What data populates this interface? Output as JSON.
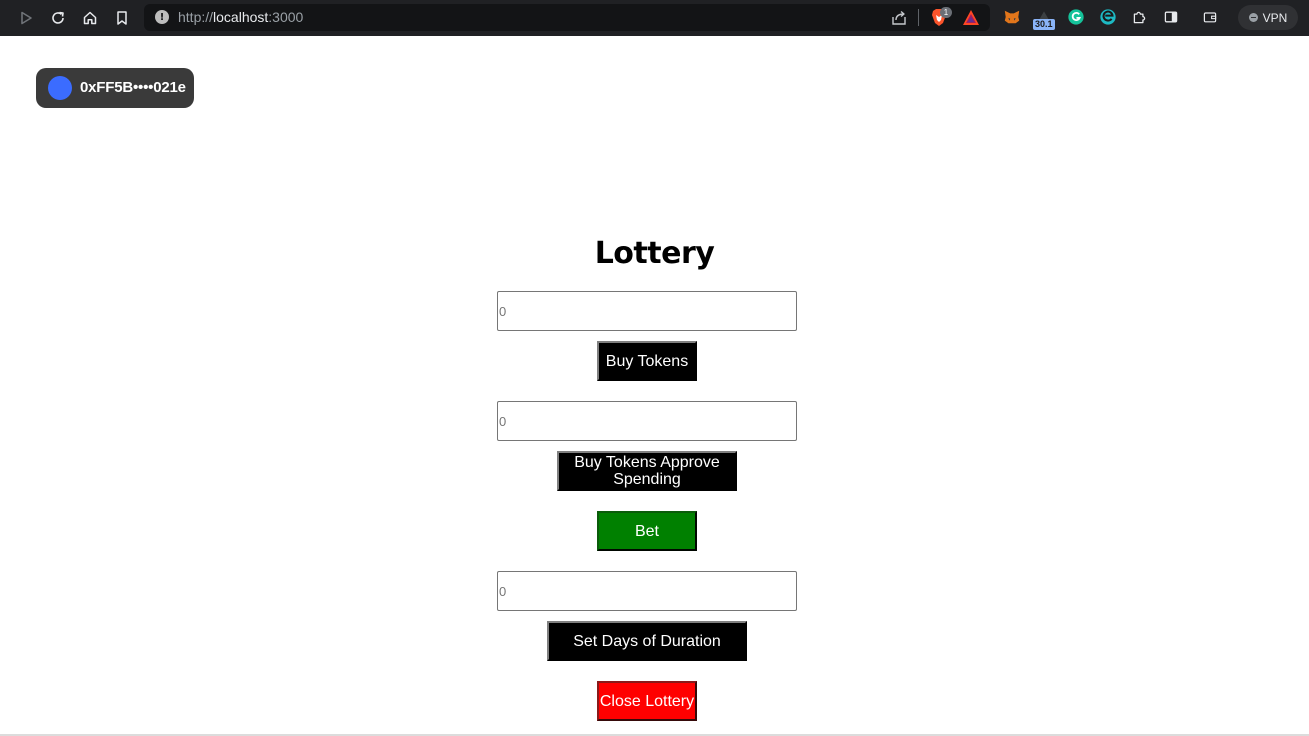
{
  "browser": {
    "url_scheme": "http://",
    "url_host": "localhost",
    "url_port": ":3000",
    "brave_badge": "1",
    "extension_badge": "30.1",
    "vpn_label": "VPN"
  },
  "wallet": {
    "address": "0xFF5B••••021e",
    "avatar_color": "#3b6cff"
  },
  "lottery": {
    "title": "Lottery",
    "buy_tokens_input": {
      "placeholder": "0",
      "value": ""
    },
    "buy_tokens_label": "Buy Tokens",
    "approve_input": {
      "placeholder": "0",
      "value": ""
    },
    "approve_label_line1": "Buy Tokens Approve",
    "approve_label_line2": "Spending",
    "bet_label": "Bet",
    "duration_input": {
      "placeholder": "0",
      "value": ""
    },
    "duration_label": "Set Days of Duration",
    "close_label": "Close Lottery"
  },
  "colors": {
    "bet_button": "#008000",
    "close_button": "#ff0000",
    "primary_button": "#000000"
  }
}
